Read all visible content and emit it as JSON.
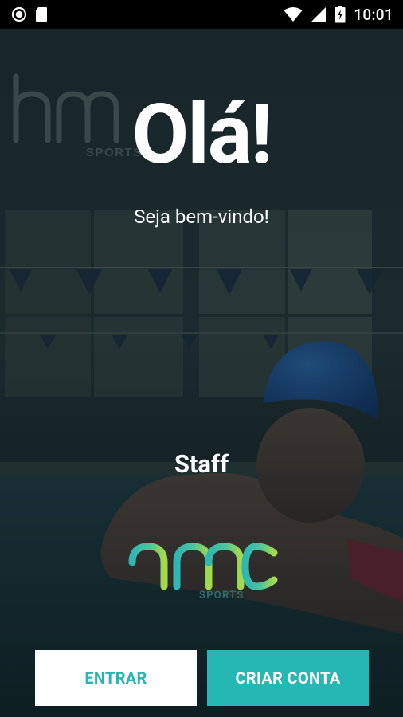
{
  "status_bar": {
    "time": "10:01",
    "left_icons": [
      "record-icon",
      "sd-card-icon"
    ],
    "right_icons": [
      "wifi-icon",
      "signal-icon",
      "battery-charging-icon"
    ]
  },
  "hero": {
    "title": "Olá!",
    "subtitle": "Seja bem-vindo!"
  },
  "staff_label": "Staff",
  "brand": {
    "name": "hmc",
    "sub": "SPORTS",
    "gradient_start": "#2fb6b3",
    "gradient_end": "#a6d94a"
  },
  "watermark": {
    "name": "hmc",
    "sub": "SPORTS"
  },
  "buttons": {
    "login": "ENTRAR",
    "register": "CRIAR CONTA"
  },
  "colors": {
    "accent": "#25b7b3",
    "overlay": "#0f1a1c"
  }
}
